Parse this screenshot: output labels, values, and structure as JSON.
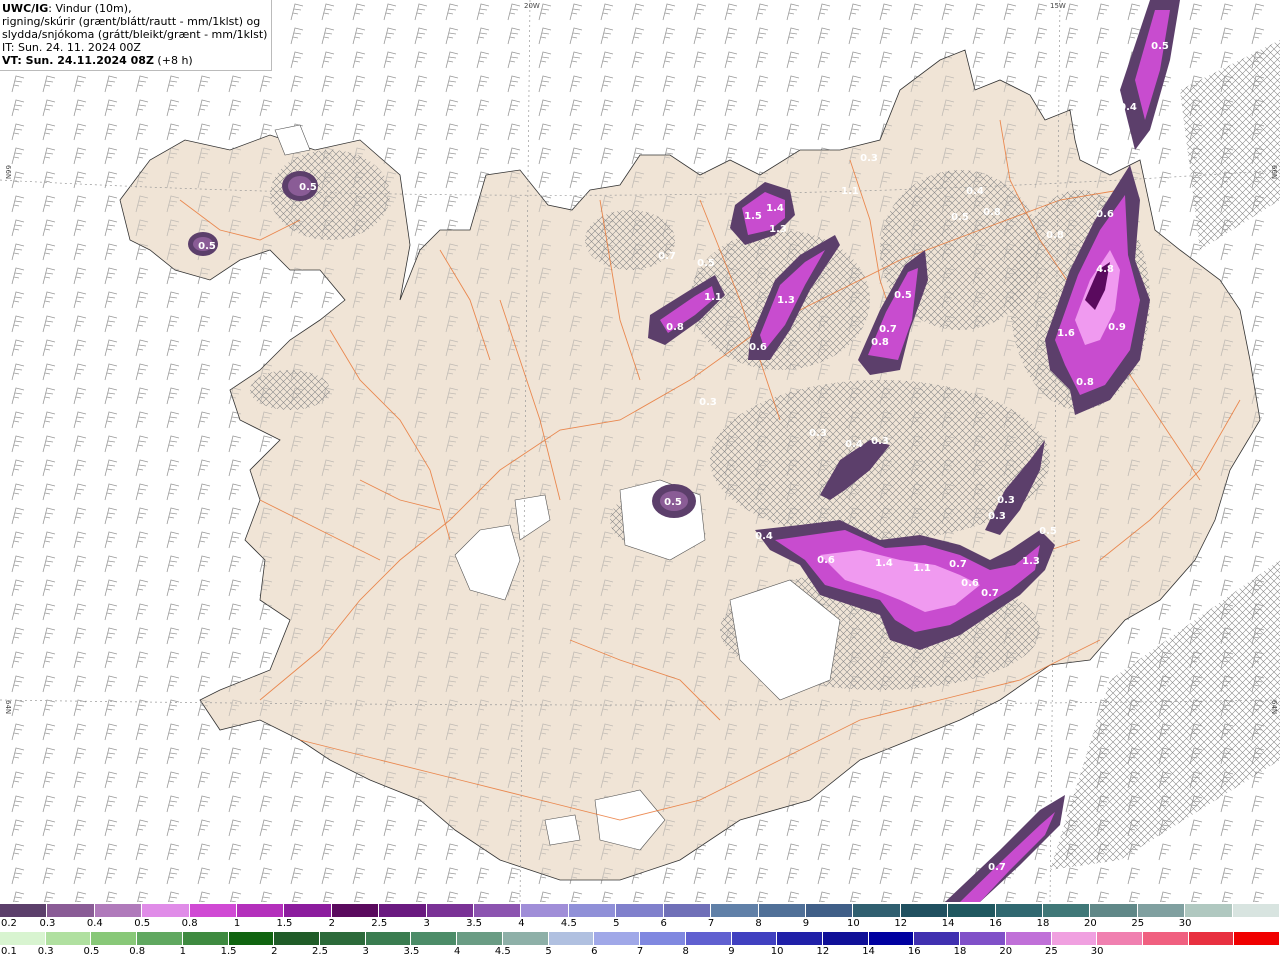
{
  "header": {
    "model": "UWC/IG",
    "line1": ": Vindur (10m),",
    "line2": "rigning/skúrir (grænt/blátt/rautt - mm/1klst) og",
    "line3": "slydda/snjókoma (grátt/bleikt/grænt - mm/1klst)",
    "line4": "IT: Sun. 24. 11. 2024 00Z",
    "line5": "VT: Sun. 24.11.2024 08Z",
    "line5_suffix": " (+8 h)"
  },
  "coords": {
    "lon_20w": "20W",
    "lon_15w": "15W",
    "lat_66n_left": "66N",
    "lat_66n_right": "66N",
    "lat_64n_left": "64N",
    "lat_64n_right": "64N"
  },
  "precip_labels": [
    "0.5",
    "0.5",
    "1.5",
    "1.4",
    "1.3",
    "1.1",
    "0.4",
    "0.5",
    "0.8",
    "0.3",
    "0.7",
    "0.5",
    "1.1",
    "0.8",
    "1.3",
    "0.6",
    "0.5",
    "0.7",
    "0.8",
    "0.3",
    "0.3",
    "0.4",
    "0.3",
    "0.5",
    "0.4",
    "0.6",
    "1.4",
    "1.1",
    "0.7",
    "0.6",
    "0.7",
    "1.3",
    "0.5",
    "0.3",
    "0.3",
    "0.6",
    "0.8",
    "4.8",
    "1.6",
    "0.9",
    "0.8",
    "0.5",
    "0.4",
    "0.7",
    "0.7"
  ],
  "colors": {
    "land": "#f0e4d6",
    "sea": "#ffffff",
    "roads": "#e8722e",
    "precip_light": "#5c3f6b",
    "precip_mid": "#c84ccf",
    "precip_bright": "#f09af0"
  },
  "colorbar_snow": {
    "colors": [
      "#5c3f6b",
      "#8a5c96",
      "#b07abb",
      "#e08ce8",
      "#d04ad4",
      "#b430bc",
      "#8c1c9e",
      "#5a0a5e",
      "#6a1a80",
      "#7a3296",
      "#8c54b0",
      "#a08ed8",
      "#9090d8",
      "#8080cc",
      "#7070b8",
      "#6080a8",
      "#507098",
      "#405f88",
      "#305f70",
      "#205060",
      "#205860",
      "#306870",
      "#407878",
      "#608888",
      "#80a0a0",
      "#b0c8c0",
      "#d8e4e0"
    ],
    "labels": [
      "0.2",
      "0.3",
      "0.4",
      "0.5",
      "0.8",
      "1",
      "1.5",
      "2",
      "2.5",
      "3",
      "3.5",
      "4",
      "4.5",
      "5",
      "6",
      "7",
      "8",
      "9",
      "10",
      "12",
      "14",
      "16",
      "18",
      "20",
      "25",
      "30"
    ]
  },
  "colorbar_rain": {
    "colors": [
      "#d8f4d0",
      "#b0e0a0",
      "#88c878",
      "#60a860",
      "#3e8a40",
      "#106410",
      "#205c28",
      "#2c6a3a",
      "#3a7c50",
      "#4c8c68",
      "#6a9c84",
      "#8eb0a8",
      "#b0c0e0",
      "#a0a8e8",
      "#8088e0",
      "#6060d0",
      "#4040c0",
      "#2020a8",
      "#101098",
      "#0000a0",
      "#4030b0",
      "#8050c8",
      "#c070d8",
      "#f0a0e0",
      "#f080b0",
      "#f06080",
      "#e83040",
      "#f00000"
    ],
    "labels": [
      "0.1",
      "0.3",
      "0.5",
      "0.8",
      "1",
      "1.5",
      "2",
      "2.5",
      "3",
      "3.5",
      "4",
      "4.5",
      "5",
      "6",
      "7",
      "8",
      "9",
      "10",
      "12",
      "14",
      "16",
      "18",
      "20",
      "25",
      "30"
    ]
  }
}
